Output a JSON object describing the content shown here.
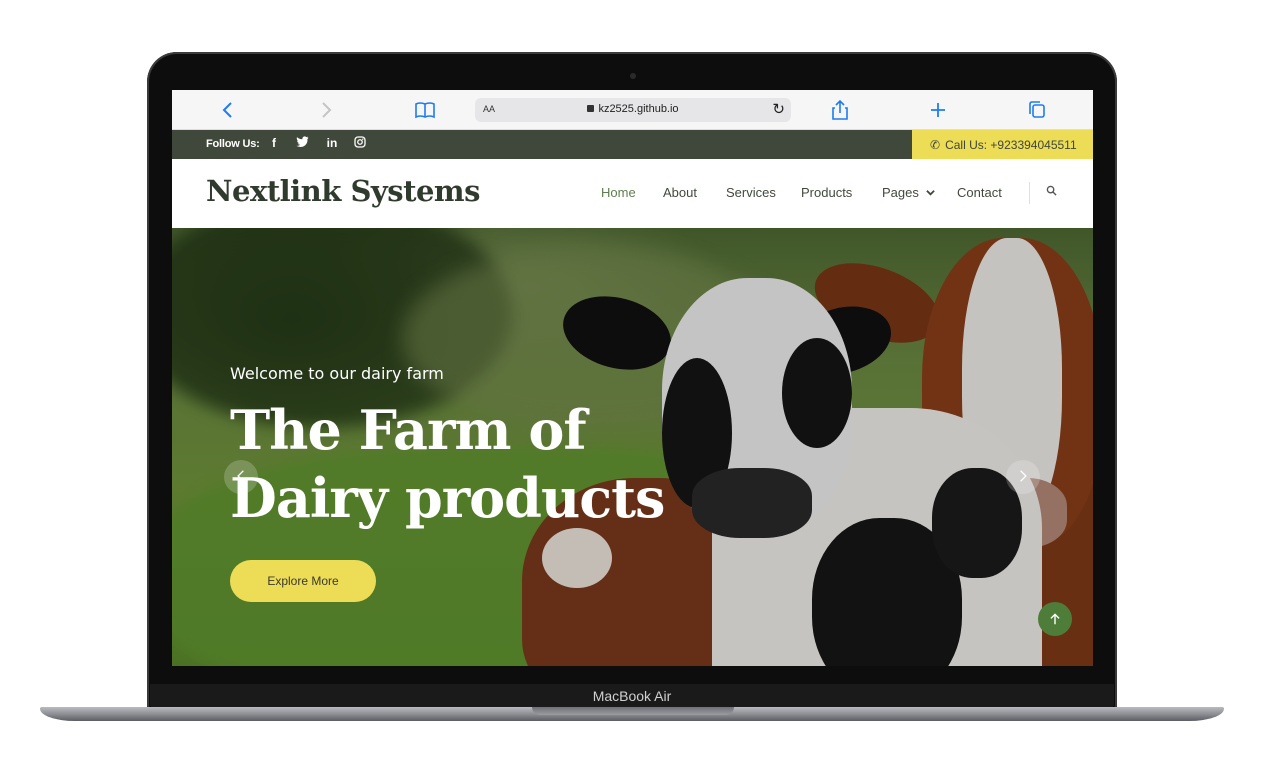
{
  "device": {
    "label": "MacBook Air"
  },
  "safari": {
    "back_icon": "chevron-left-icon",
    "forward_icon": "chevron-right-icon",
    "bookmarks_icon": "book-icon",
    "aa_label": "AA",
    "url": "kz2525.github.io",
    "reload_icon": "reload-icon",
    "share_icon": "share-icon",
    "new_tab_icon": "plus-icon",
    "tabs_icon": "tabs-icon"
  },
  "topbar": {
    "follow_label": "Follow Us:",
    "social": [
      "f",
      "t",
      "in",
      "ig"
    ],
    "call_label": "Call Us:",
    "phone": "+923394045511"
  },
  "navbar": {
    "logo": "Nextlink Systems",
    "items": [
      "Home",
      "About",
      "Services",
      "Products",
      "Pages",
      "Contact"
    ],
    "active_item": "Home"
  },
  "hero": {
    "subtitle": "Welcome to our dairy farm",
    "title": "The Farm of Dairy products",
    "button_label": "Explore More"
  },
  "colors": {
    "topbar_bg": "#40473b",
    "accent_yellow": "#eddc55",
    "nav_active": "#5e7f4e",
    "back_to_top": "#4e7d3a"
  }
}
